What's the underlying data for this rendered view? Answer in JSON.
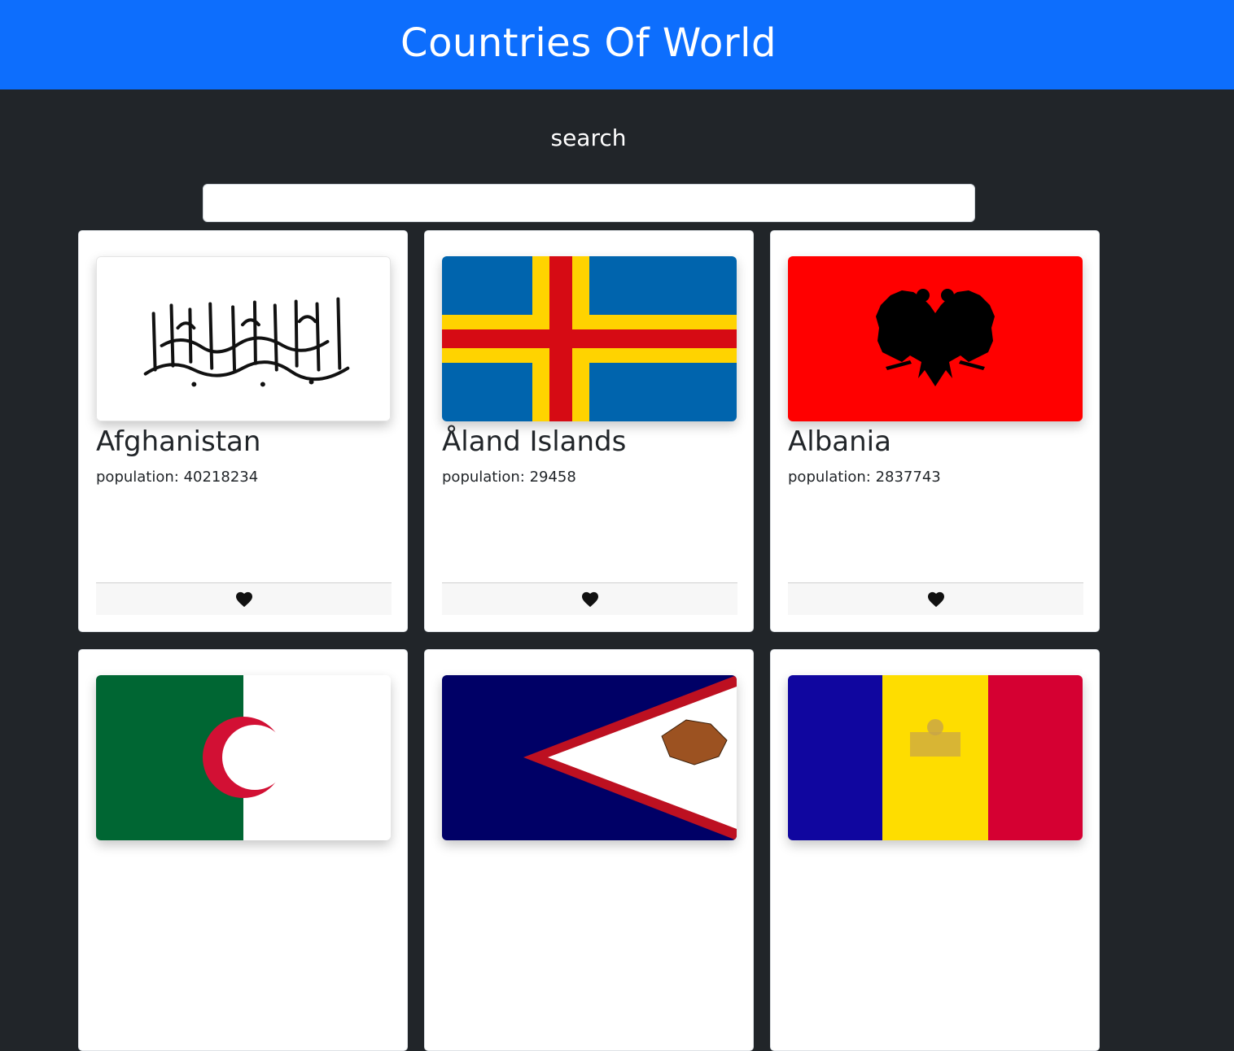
{
  "header": {
    "title": "Countries Of World"
  },
  "search": {
    "label": "search",
    "value": "",
    "placeholder": ""
  },
  "colors": {
    "navbar": "#0d6efd",
    "background": "#212529",
    "card": "#ffffff"
  },
  "countries": [
    {
      "name": "Afghanistan",
      "population_label": "population: 40218234",
      "flag_icon": "afghanistan-flag-icon"
    },
    {
      "name": "Åland Islands",
      "population_label": "population: 29458",
      "flag_icon": "aland-islands-flag-icon"
    },
    {
      "name": "Albania",
      "population_label": "population: 2837743",
      "flag_icon": "albania-flag-icon"
    },
    {
      "name": "",
      "population_label": "",
      "flag_icon": "algeria-flag-icon"
    },
    {
      "name": "",
      "population_label": "",
      "flag_icon": "american-samoa-flag-icon"
    },
    {
      "name": "",
      "population_label": "",
      "flag_icon": "andorra-flag-icon"
    }
  ],
  "favorite_icon": "heart-icon"
}
